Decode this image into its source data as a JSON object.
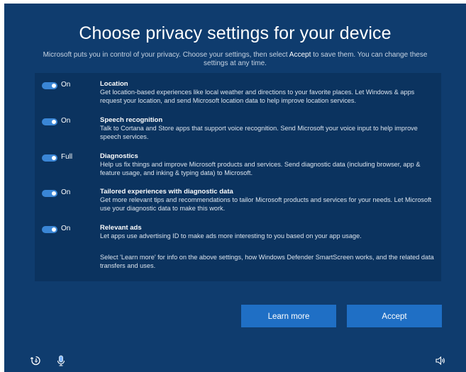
{
  "header": {
    "title": "Choose privacy settings for your device",
    "subtitle_before": "Microsoft puts you in control of your privacy.  Choose your settings, then select ",
    "subtitle_emph": "Accept",
    "subtitle_after": " to save them. You can change these settings at any time."
  },
  "settings": [
    {
      "state": "On",
      "title": "Location",
      "description": "Get location-based experiences like local weather and directions to your favorite places.  Let Windows & apps request your location, and send Microsoft location data to help improve location services."
    },
    {
      "state": "On",
      "title": "Speech recognition",
      "description": "Talk to Cortana and Store apps that support voice recognition.  Send Microsoft your voice input to help improve speech services."
    },
    {
      "state": "Full",
      "title": "Diagnostics",
      "description": "Help us fix things and improve Microsoft products and services.  Send diagnostic data (including browser, app & feature usage, and inking & typing data) to Microsoft."
    },
    {
      "state": "On",
      "title": "Tailored experiences with diagnostic data",
      "description": "Get more relevant tips and recommendations to tailor Microsoft products and services for your needs. Let Microsoft use your diagnostic data to make this work."
    },
    {
      "state": "On",
      "title": "Relevant ads",
      "description": "Let apps use advertising ID to make ads more interesting to you based on your app usage."
    }
  ],
  "footer_note": "Select 'Learn more' for info on the above settings, how Windows Defender SmartScreen works, and the related data transfers and uses.",
  "buttons": {
    "learn_more": "Learn more",
    "accept": "Accept"
  },
  "icons": {
    "ease_of_access": "ease-of-access-icon",
    "microphone": "microphone-icon",
    "volume": "volume-icon"
  },
  "colors": {
    "background": "#0f3c6e",
    "panel": "#0b335f",
    "accent": "#1f6fc5",
    "toggle": "#3a86d6"
  }
}
